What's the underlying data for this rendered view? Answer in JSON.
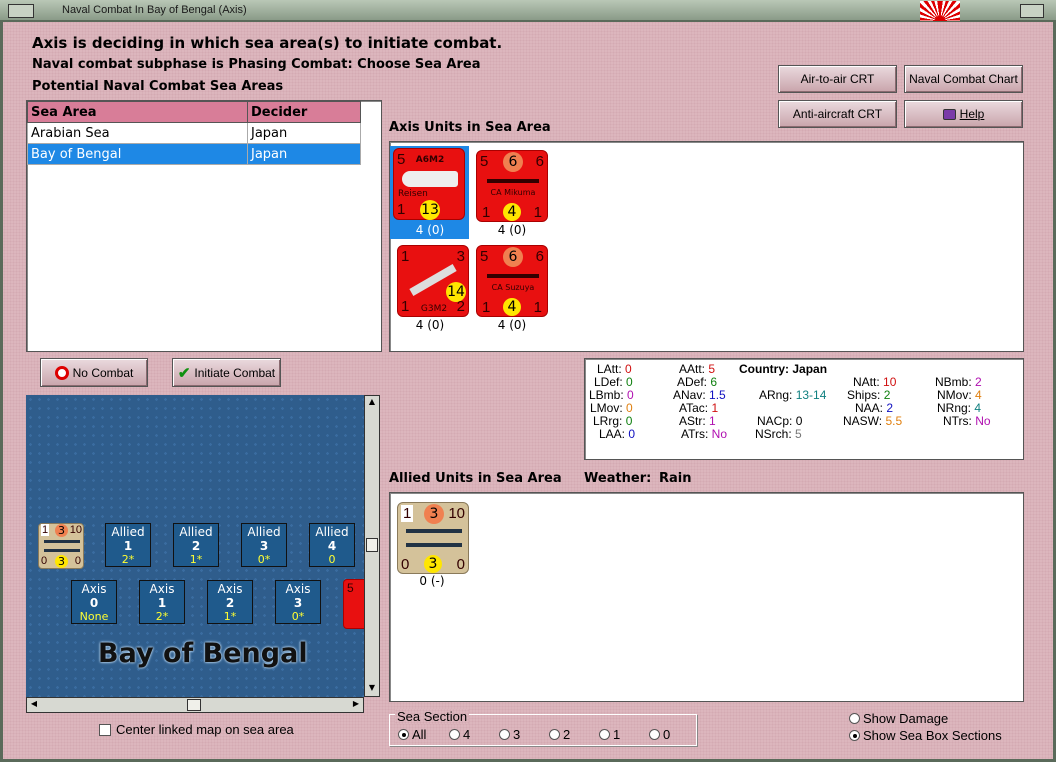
{
  "window": {
    "title": "Naval Combat In Bay of Bengal (Axis)"
  },
  "header": {
    "line1": "Axis is deciding in which sea area(s) to initiate combat.",
    "line2": "Naval combat subphase is Phasing Combat: Choose Sea Area",
    "line3": "Potential Naval Combat Sea Areas"
  },
  "buttons": {
    "air_to_air": "Air-to-air CRT",
    "naval_chart": "Naval Combat Chart",
    "anti_aircraft": "Anti-aircraft CRT",
    "help": "Help",
    "no_combat": "No Combat",
    "initiate_combat": "Initiate Combat"
  },
  "sea_table": {
    "headers": [
      "Sea Area",
      "Decider"
    ],
    "rows": [
      {
        "area": "Arabian Sea",
        "decider": "Japan"
      },
      {
        "area": "Bay of Bengal",
        "decider": "Japan"
      }
    ]
  },
  "axis_units": {
    "title": "Axis Units in Sea Area",
    "units": [
      {
        "name": "A6M2",
        "subname": "Reisen",
        "tl": "5",
        "tr": "",
        "bl": "1",
        "br": "",
        "circle": "13",
        "label": "4 (0)"
      },
      {
        "name": "CA Mikuma",
        "tl": "5",
        "mid": "6",
        "tr": "6",
        "bl": "1",
        "circle": "4",
        "br": "1",
        "label": "4 (0)"
      },
      {
        "name": "G3M2",
        "tl": "1",
        "tr": "3",
        "bl": "1",
        "circle": "14",
        "br": "2",
        "label": "4 (0)"
      },
      {
        "name": "CA Suzuya",
        "tl": "5",
        "mid": "6",
        "tr": "6",
        "bl": "1",
        "circle": "4",
        "br": "1",
        "label": "4 (0)"
      }
    ]
  },
  "stats": {
    "latt": {
      "k": "LAtt:",
      "v": "0"
    },
    "ldef": {
      "k": "LDef:",
      "v": "0"
    },
    "lbmb": {
      "k": "LBmb:",
      "v": "0"
    },
    "lmov": {
      "k": "LMov:",
      "v": "0"
    },
    "lrrg": {
      "k": "LRrg:",
      "v": "0"
    },
    "laa": {
      "k": "LAA:",
      "v": "0"
    },
    "aatt": {
      "k": "AAtt:",
      "v": "5"
    },
    "adef": {
      "k": "ADef:",
      "v": "6"
    },
    "anav": {
      "k": "ANav:",
      "v": "1.5"
    },
    "atac": {
      "k": "ATac:",
      "v": "1"
    },
    "astr": {
      "k": "AStr:",
      "v": "1"
    },
    "atrs": {
      "k": "ATrs:",
      "v": "No"
    },
    "country": {
      "k": "Country:",
      "v": "Japan"
    },
    "arng": {
      "k": "ARng:",
      "v": "13-14"
    },
    "nacp": {
      "k": "NACp:",
      "v": "0"
    },
    "nsrch": {
      "k": "NSrch:",
      "v": "5"
    },
    "natt": {
      "k": "NAtt:",
      "v": "10"
    },
    "ships": {
      "k": "Ships:",
      "v": "2"
    },
    "naa": {
      "k": "NAA:",
      "v": "2"
    },
    "nasw": {
      "k": "NASW:",
      "v": "5.5"
    },
    "nbmb": {
      "k": "NBmb:",
      "v": "2"
    },
    "nmov": {
      "k": "NMov:",
      "v": "4"
    },
    "nrng": {
      "k": "NRng:",
      "v": "4"
    },
    "ntrs": {
      "k": "NTrs:",
      "v": "No"
    }
  },
  "allied": {
    "title": "Allied Units in Sea Area",
    "weather_label": "Weather:",
    "weather": "Rain",
    "unit": {
      "tl": "1",
      "mid": "3",
      "tr": "10",
      "bl": "0",
      "circle": "3",
      "br": "0",
      "label": "0 (-)"
    }
  },
  "map": {
    "name": "Bay of Bengal",
    "allied_boxes": [
      {
        "side": "Allied",
        "num": "1",
        "val": "2*"
      },
      {
        "side": "Allied",
        "num": "2",
        "val": "1*"
      },
      {
        "side": "Allied",
        "num": "3",
        "val": "0*"
      },
      {
        "side": "Allied",
        "num": "4",
        "val": "0"
      }
    ],
    "axis_boxes": [
      {
        "side": "Axis",
        "num": "0",
        "val": "None"
      },
      {
        "side": "Axis",
        "num": "1",
        "val": "2*"
      },
      {
        "side": "Axis",
        "num": "2",
        "val": "1*"
      },
      {
        "side": "Axis",
        "num": "3",
        "val": "0*"
      }
    ],
    "stack": {
      "tl": "1",
      "mid": "3",
      "tr": "10",
      "bl": "0",
      "circle": "3",
      "br": "0"
    },
    "red_stack": {
      "tl": "5"
    }
  },
  "center_linked": "Center linked map on sea area",
  "sea_section": {
    "title": "Sea Section",
    "options": [
      "All",
      "4",
      "3",
      "2",
      "1",
      "0"
    ],
    "selected": "All"
  },
  "show": {
    "damage": "Show Damage",
    "sections": "Show Sea Box Sections"
  },
  "colors": {
    "background": "#dcb6bd",
    "selected_row": "#1e88e5",
    "counter_axis": "#e81010",
    "map_sea": "#2f5d8c"
  }
}
